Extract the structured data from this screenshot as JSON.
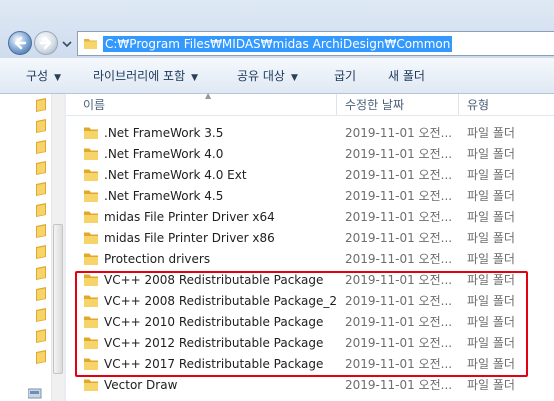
{
  "address": {
    "path": "C:₩Program Files₩MIDAS₩midas ArchiDesign₩Common"
  },
  "toolbar": {
    "organize": "구성",
    "include_in_library": "라이브러리에 포함",
    "share_with": "공유 대상",
    "burn": "굽기",
    "new_folder": "새 폴더"
  },
  "columns": {
    "name": "이름",
    "date_modified": "수정한 날짜",
    "type": "유형"
  },
  "files": [
    {
      "name": ".Net FrameWork 3.5",
      "date": "2019-11-01 오전...",
      "type": "파일 폴더"
    },
    {
      "name": ".Net FrameWork 4.0",
      "date": "2019-11-01 오전...",
      "type": "파일 폴더"
    },
    {
      "name": ".Net FrameWork 4.0 Ext",
      "date": "2019-11-01 오전...",
      "type": "파일 폴더"
    },
    {
      "name": ".Net FrameWork 4.5",
      "date": "2019-11-01 오전...",
      "type": "파일 폴더"
    },
    {
      "name": "midas File Printer Driver x64",
      "date": "2019-11-01 오전...",
      "type": "파일 폴더"
    },
    {
      "name": "midas File Printer Driver x86",
      "date": "2019-11-01 오전...",
      "type": "파일 폴더"
    },
    {
      "name": "Protection drivers",
      "date": "2019-11-01 오전...",
      "type": "파일 폴더"
    },
    {
      "name": "VC++ 2008 Redistributable Package",
      "date": "2019-11-01 오전...",
      "type": "파일 폴더"
    },
    {
      "name": "VC++ 2008 Redistributable Package_2",
      "date": "2019-11-01 오전...",
      "type": "파일 폴더"
    },
    {
      "name": "VC++ 2010 Redistributable Package",
      "date": "2019-11-01 오전...",
      "type": "파일 폴더"
    },
    {
      "name": "VC++ 2012 Redistributable Package",
      "date": "2019-11-01 오전...",
      "type": "파일 폴더"
    },
    {
      "name": "VC++ 2017 Redistributable Package",
      "date": "2019-11-01 오전...",
      "type": "파일 폴더"
    },
    {
      "name": "Vector Draw",
      "date": "2019-11-01 오전...",
      "type": "파일 폴더"
    }
  ],
  "icons": {
    "back": "back-arrow-icon",
    "forward": "forward-arrow-icon",
    "folder": "folder-icon"
  },
  "colors": {
    "selection": "#3399ff",
    "annotation": "#e3000f",
    "folder": "#f2c94c"
  }
}
